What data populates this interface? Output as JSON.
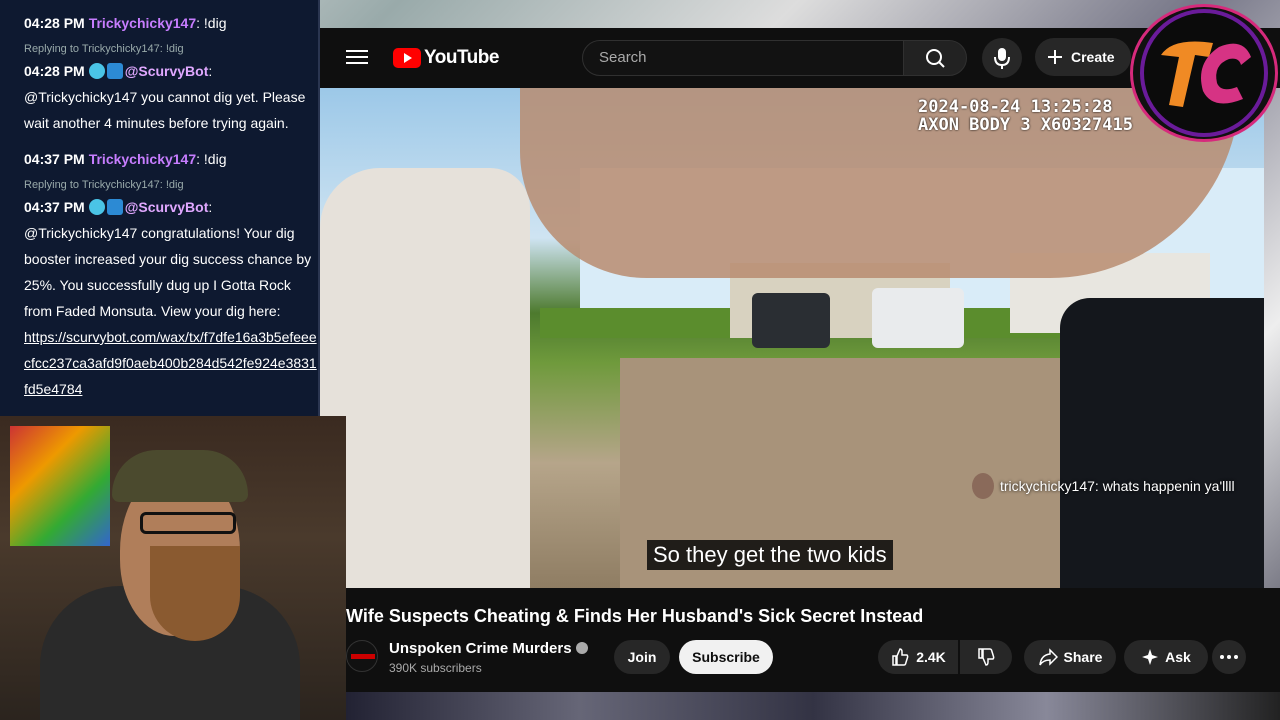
{
  "youtube": {
    "logo_text": "YouTube",
    "search_placeholder": "Search",
    "create_label": "Create"
  },
  "video": {
    "timestamp_line1": "2024-08-24 13:25:28",
    "timestamp_line2": "AXON BODY 3 X60327415",
    "subtitle": "So they get the two kids",
    "overlay_chat": "trickychicky147: whats happenin ya'llll"
  },
  "info": {
    "title": "Wife Suspects Cheating & Finds Her Husband's Sick Secret Instead",
    "channel": "Unspoken Crime Murders",
    "subscribers": "390K subscribers",
    "join": "Join",
    "subscribe": "Subscribe",
    "likes": "2.4K",
    "share": "Share",
    "ask": "Ask"
  },
  "chat": {
    "m1_time": "04:28 PM",
    "m1_user": "Trickychicky147",
    "m1_text": ": !dig",
    "r1": "Replying to Trickychicky147: !dig",
    "m2_time": "04:28 PM",
    "m2_user": "@ScurvyBot",
    "m2_text": "@Trickychicky147 you cannot dig yet. Please wait another 4 minutes before trying again.",
    "m3_time": "04:37 PM",
    "m3_user": "Trickychicky147",
    "m3_text": ": !dig",
    "r2": "Replying to Trickychicky147: !dig",
    "m4_time": "04:37 PM",
    "m4_user": "@ScurvyBot",
    "m4_text": "@Trickychicky147 congratulations! Your dig booster increased your dig success chance by 25%. You successfully dug up I Gotta Rock from Faded Monsuta. View your dig here:",
    "m4_link": "https://scurvybot.com/wax/tx/f7dfe16a3b5efeeecfcc237ca3afd9f0aeb400b284d542fe924e3831fd5e4784"
  },
  "colors": {
    "yt_red": "#ff0000",
    "chat_bg": "#0e1930",
    "username": "#c77dff"
  }
}
